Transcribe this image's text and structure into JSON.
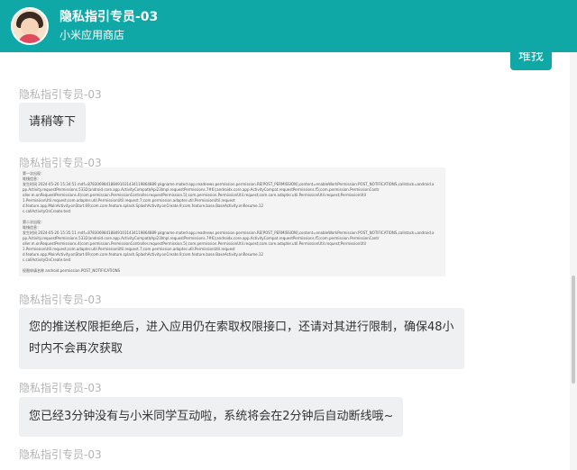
{
  "header": {
    "title": "隐私指引专员-03",
    "subtitle": "小米应用商店"
  },
  "user_message": {
    "text": "堆找"
  },
  "messages": [
    {
      "sender": "隐私指引专员-03",
      "text": "请稍等下"
    },
    {
      "sender": "隐私指引专员-03",
      "type": "image"
    },
    {
      "sender": "隐私指引专员-03",
      "text": "您的推送权限拒绝后，进入应用仍在索取权限接口，还请对其进行限制，确保48小时内不会再次获取"
    },
    {
      "sender": "隐私指引专员-03",
      "text": "您已经3分钟没有与小米同学互动啦，系统将会在2分钟后自动断线哦~"
    },
    {
      "sender": "隐私指引专员-03"
    }
  ],
  "doc_image": {
    "lines": [
      "第一次出现：",
      "堆栈信息：",
      "发生时间 2024-05-26 15:34:51 mdf=878306984188491031434119864889 pkgname.mated-app.readnews.permission.permission.RE[POST_PERMISSION],content=enableWorkPermission:POST_NOTIFICATIONS,callstack=android.a",
      "pp.Activity.requestPermissions.5332(android.core.app.ActivityCompat$Api23Impl.requestPermissions.7#6);androidx.core.app.ActivityCompat.requestPermissions.f5;com.permission.PermissionContr",
      "oller.m.onRequestPermissions.4(com.permission.PermissionController.requestPermission.5);com.permission.PermissionUtil.request;com.core.adapter.util.PermissionUtil.request;PermissionUtil",
      "1.PermissionUtil.request;com.adapter.util.PermissionUtil.request.7;com.permission.adapter.util.PermissionUtil.request",
      "d.feature.app.MainActivity.onStart.69;com.core.feature.splash.SplashActivity.onCreate.9;com.feature.base.BaseActivity.onResume.12",
      "c.callActivityOnCreate.test",
      "",
      "第二次出现：",
      "堆栈信息：",
      "发生时间 2024-05-26 15:35:11 mdf=878306984188491031434119864889 pkgname.mated-app.readnews.permission.permission.RE[POST_PERMISSION],content=enableWorkPermission:POST_NOTIFICATIONS,callstack=android.a",
      "pp.Activity.requestPermissions.5332(android.core.app.ActivityCompat$Api23Impl.requestPermissions.7#6);androidx.core.app.ActivityCompat.requestPermissions.f5;com.permission.PermissionContr",
      "oller.m.onRequestPermissions.4(com.permission.PermissionController.requestPermission.5);com.permission.PermissionUtil.request;com.core.adapter.util.PermissionUtil.request;PermissionUtil",
      "1.PermissionUtil.request;com.adapter.util.PermissionUtil.request.7;com.permission.adapter.util.PermissionUtil.request",
      "d.feature.app.MainActivity.onStart.69;com.core.feature.splash.SplashActivity.onCreate.9;com.feature.base.BaseActivity.onResume.12",
      "c.callActivityOnCreate.test",
      "",
      "权限申请名称 android.permission.POST_NOTIFICATIONS"
    ]
  },
  "colors": {
    "header_bg": "#0fa8a6",
    "bubble_bg": "#eef0f2",
    "sender_name": "#b4b4b4"
  }
}
